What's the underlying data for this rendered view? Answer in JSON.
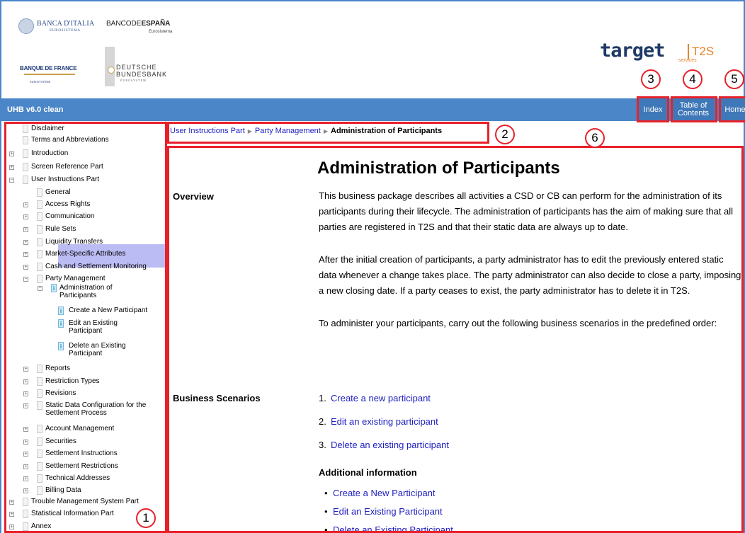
{
  "logos": {
    "banca_italia": "BANCA D'ITALIA",
    "banca_italia_sub": "EUROSISTEMA",
    "banco_espana": "BANCODE",
    "banco_espana_bold": "ESPAÑA",
    "banco_espana_sub": "Eurosistema",
    "banque_france": "BANQUE DE FRANCE",
    "banque_france_sub": "EUROSYSTÈME",
    "bundesbank_1": "DEUTSCHE",
    "bundesbank_2": "BUNDESBANK",
    "bundesbank_sub": "EUROSYSTEM",
    "target": "target",
    "t2s": "T2S",
    "services": "services"
  },
  "header": {
    "app_title": "UHB v6.0 clean",
    "nav": {
      "index": "Index",
      "toc_1": "Table of",
      "toc_2": "Contents",
      "home": "Home"
    }
  },
  "sidebar": {
    "items": [
      {
        "label": "Disclaimer"
      },
      {
        "label": "Terms and Abbreviations"
      },
      {
        "label": "Introduction"
      },
      {
        "label": "Screen Reference Part"
      },
      {
        "label": "User Instructions Part"
      },
      {
        "label": "General"
      },
      {
        "label": "Access Rights"
      },
      {
        "label": "Communication"
      },
      {
        "label": "Rule Sets"
      },
      {
        "label": "Liquidity Transfers"
      },
      {
        "label": "Market-Specific Attributes"
      },
      {
        "label": "Cash and Settlement Monitoring"
      },
      {
        "label": "Party Management"
      },
      {
        "label": "Administration of",
        "label2": "Participants"
      },
      {
        "label": "Create a New Participant"
      },
      {
        "label": "Edit an Existing",
        "label2": "Participant"
      },
      {
        "label": "Delete an Existing",
        "label2": "Participant"
      },
      {
        "label": "Reports"
      },
      {
        "label": "Restriction Types"
      },
      {
        "label": "Revisions"
      },
      {
        "label": "Static Data Configuration for the",
        "label2": "Settlement Process"
      },
      {
        "label": "Account Management"
      },
      {
        "label": "Securities"
      },
      {
        "label": "Settlement Instructions"
      },
      {
        "label": "Settlement Restrictions"
      },
      {
        "label": "Technical Addresses"
      },
      {
        "label": "Billing Data"
      },
      {
        "label": "Trouble Management System Part"
      },
      {
        "label": "Statistical Information Part"
      },
      {
        "label": "Annex"
      }
    ]
  },
  "breadcrumb": {
    "items": [
      "User Instructions Part",
      "Party Management"
    ],
    "current": "Administration of Participants"
  },
  "main": {
    "title": "Administration of Participants",
    "overview_label": "Overview",
    "overview_p1": "This business package describes all activities a CSD or CB can perform for the administration of its participants during their lifecycle. The administration of participants has the aim of making sure that all parties are registered in T2S and that their static data are always up to date.",
    "overview_p2": "After the initial creation of participants, a party administrator has to edit the previously entered static data whenever a change takes place. The party administrator can also decide to close a party, imposing a new closing date. If a party ceases to exist, the party administrator has to delete it in T2S.",
    "overview_p3": "To administer your participants, carry out the following business scenarios in the predefined order:",
    "scenarios_label": "Business Scenarios",
    "steps": [
      {
        "n": "1.",
        "text": "Create a new participant"
      },
      {
        "n": "2.",
        "text": "Edit an existing participant"
      },
      {
        "n": "3.",
        "text": "Delete an existing participant"
      }
    ],
    "additional_title": "Additional information",
    "bullets": [
      {
        "dot": "•",
        "text": "Create a New Participant"
      },
      {
        "dot": "•",
        "text": "Edit an Existing Participant"
      },
      {
        "dot": "•",
        "text": "Delete an Existing Participant"
      }
    ]
  },
  "callouts": [
    "1",
    "2",
    "3",
    "4",
    "5",
    "6"
  ],
  "colors": {
    "accent": "#4a86c8",
    "annotation": "#e8202a",
    "selection": "#bcbcf4",
    "link": "#2020c0"
  }
}
